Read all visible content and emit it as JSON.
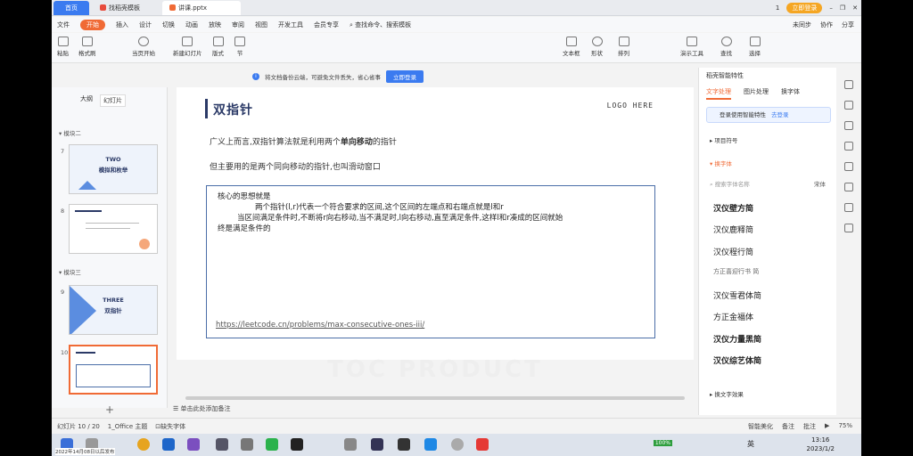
{
  "tabs": {
    "home": "首页",
    "t1": "找稻壳模板",
    "t2": "讲课.pptx"
  },
  "window_right": {
    "badge": "1",
    "login": "立即登录"
  },
  "menu": {
    "file": "文件",
    "start": "开始",
    "items": [
      "插入",
      "设计",
      "切换",
      "动画",
      "放映",
      "审阅",
      "视图",
      "开发工具",
      "会员专享"
    ],
    "search": "查找命令、搜索模板",
    "right": [
      "未同步",
      "协作",
      "分享"
    ]
  },
  "toolbar": {
    "paste": "粘贴",
    "format_painter": "格式刷",
    "from_current": "当页开始",
    "new_slide": "新建幻灯片",
    "layout": "版式",
    "section": "节",
    "textbox": "文本框",
    "shape": "形状",
    "arrange": "排列",
    "find": "查找",
    "select": "选择",
    "tools": "演示工具"
  },
  "notice": {
    "text": "将文档备份云端，可避免文件丢失，省心省事",
    "button": "立即登录"
  },
  "left_panel": {
    "tab_outline": "大纲",
    "tab_slides": "幻灯片",
    "section2": "模块二",
    "section3": "模块三",
    "slides": [
      {
        "num": "7",
        "title1": "TWO",
        "title2": "模拟和枚举"
      },
      {
        "num": "8",
        "title1": "",
        "title2": ""
      },
      {
        "num": "9",
        "title1": "THREE",
        "title2": "双指针"
      },
      {
        "num": "10",
        "title1": "",
        "title2": ""
      }
    ],
    "add": "+"
  },
  "slide": {
    "title": "双指针",
    "logo": "LOGO HERE",
    "p1_a": "广义上而言,双指针算法就是利用两个",
    "p1_b": "单向移动",
    "p1_c": "的指针",
    "p2": "但主要用的是两个同向移动的指针,也叫滑动窗口",
    "box": {
      "l1": "核心的思想就是",
      "l2": "两个指针(l,r)代表一个符合要求的区间,这个区间的左端点和右端点就是l和r",
      "l3": "当区间满足条件时,不断将r向右移动,当不满足时,l向右移动,直至满足条件,这样l和r凑成的区间就始",
      "l4": "终是满足条件的",
      "link": "https://leetcode.cn/problems/max-consecutive-ones-iii/"
    },
    "watermark": "TOC PRODUCT"
  },
  "notes": "单击此处添加备注",
  "right_panel": {
    "title": "稻壳智能特性",
    "tabs": [
      "文字处理",
      "图片处理",
      "换字体"
    ],
    "login_text": "登录使用智能特性",
    "login_link": "去登录",
    "sec_project": "项目符号",
    "sec_font": "换字体",
    "search_placeholder": "搜索字体名称",
    "default": "宋体",
    "fonts": [
      "汉仪壁方简",
      "汉仪鹿释简",
      "汉仪程行简",
      "方正喜迎行书 简",
      "汉仪雪君体简",
      "方正金福体",
      "汉仪力量黑简",
      "汉仪综艺体简"
    ],
    "sec_effect": "换文字效果"
  },
  "status": {
    "slide_info": "幻灯片 10 / 20",
    "theme": "1_Office 主题",
    "missing_font": "缺失字体",
    "beautify": "智能美化",
    "notes": "备注",
    "comment": "批注",
    "zoom": "75%"
  },
  "taskbar": {
    "battery": "100%",
    "lang": "英",
    "time": "13:16",
    "date": "2023/1/2",
    "caption": "2022年14月08日以后发布"
  }
}
